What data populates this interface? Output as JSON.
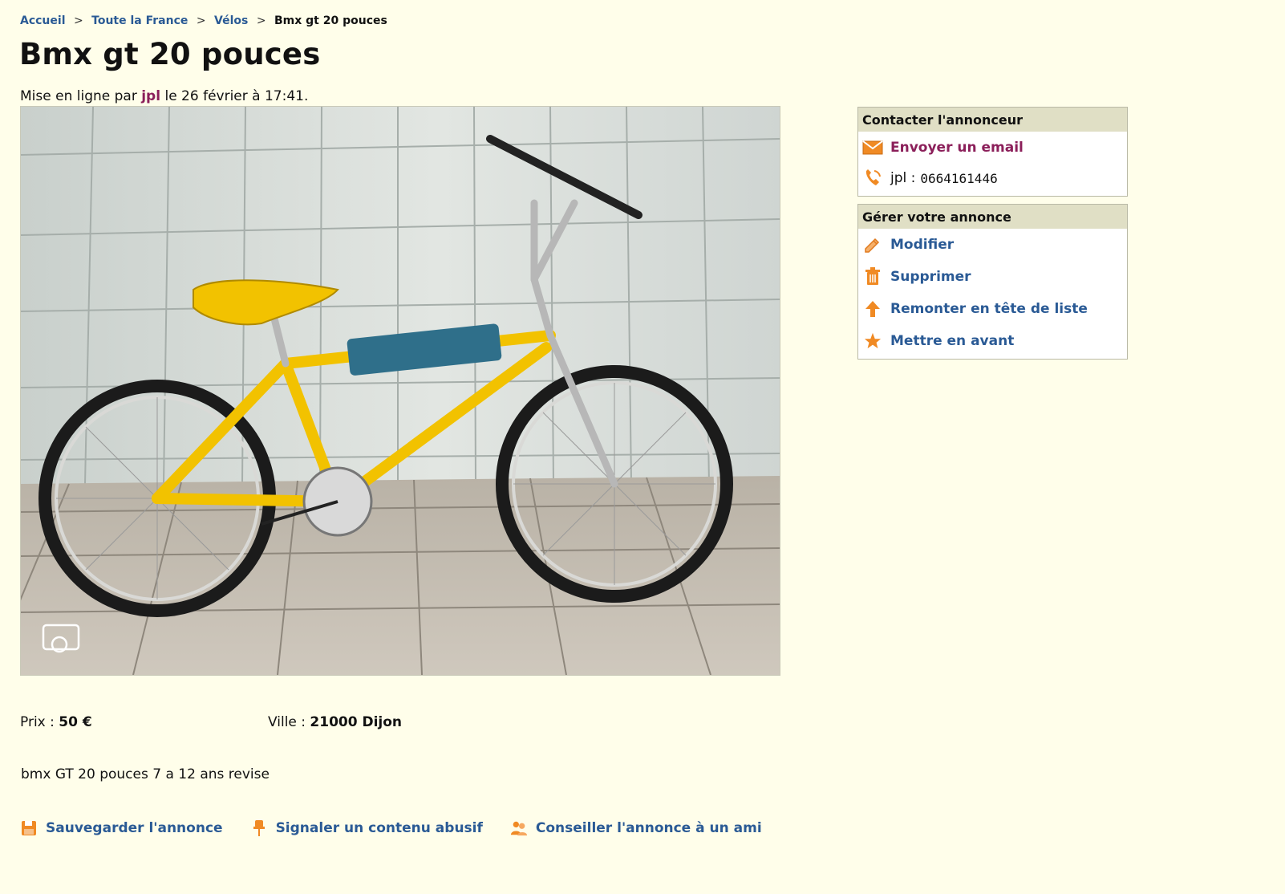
{
  "breadcrumb": {
    "items": [
      "Accueil",
      "Toute la France",
      "Vélos"
    ],
    "separator": ">",
    "current": "Bmx gt 20 pouces"
  },
  "title": "Bmx gt 20 pouces",
  "posted": {
    "prefix": "Mise en ligne par",
    "author": "jpl",
    "suffix": "le 26 février à 17:41."
  },
  "contact": {
    "heading": "Contacter l'annonceur",
    "email_label": "Envoyer un email",
    "phone_name": "jpl :",
    "phone_number": "0664161446"
  },
  "manage": {
    "heading": "Gérer votre annonce",
    "items": [
      "Modifier",
      "Supprimer",
      "Remonter en tête de liste",
      "Mettre en avant"
    ]
  },
  "details": {
    "price_label": "Prix :",
    "price_value": "50 €",
    "city_label": "Ville :",
    "city_value": "21000 Dijon"
  },
  "description": "bmx GT 20 pouces 7 a 12 ans revise",
  "actions": [
    "Sauvegarder l'annonce",
    "Signaler un contenu abusif",
    "Conseiller l'annonce à un ami"
  ],
  "colors": {
    "background": "#fffeea",
    "link": "#2a5a95",
    "author": "#8b1f5a",
    "box_header": "#e0dfc5",
    "icon_orange": "#f08a24"
  },
  "icons": {
    "email": "envelope-icon",
    "phone": "phone-icon",
    "modify": "pencil-icon",
    "delete": "trash-icon",
    "bump": "arrow-up-icon",
    "feature": "star-icon",
    "save": "floppy-icon",
    "report": "pin-icon",
    "share": "people-icon"
  }
}
